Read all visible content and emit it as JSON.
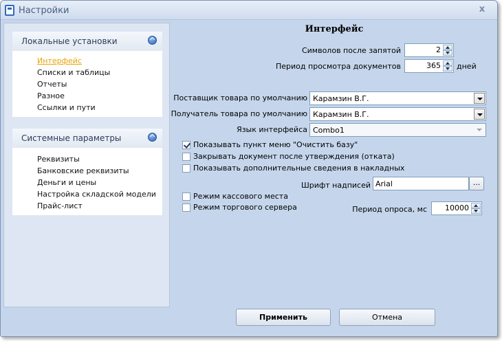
{
  "window": {
    "title": "Настройки",
    "close_glyph": "x"
  },
  "nav": {
    "local": {
      "title": "Локальные установки",
      "items": [
        "Интерфейс",
        "Списки и таблицы",
        "Отчеты",
        "Разное",
        "Ссылки и пути"
      ]
    },
    "system": {
      "title": "Системные параметры",
      "items": [
        "Реквизиты",
        "Банковские реквизиты",
        "Деньги и цены",
        "Настройка складской модели",
        "Прайс-лист"
      ]
    }
  },
  "form": {
    "heading": "Интерфейс",
    "decimals_label": "Символов после запятой",
    "decimals_value": "2",
    "period_label": "Период просмотра документов",
    "period_value": "365",
    "period_unit": "дней",
    "supplier_label": "Поставщик товара по умолчанию",
    "supplier_value": "Карамзин В.Г.",
    "receiver_label": "Получатель товара по умолчанию",
    "receiver_value": "Карамзин В.Г.",
    "language_label": "Язык интерфейса",
    "language_value": "Combo1",
    "check_clear_db": "Показывать пункт меню \"Очистить базу\"",
    "check_close_doc": "Закрывать документ после утверждения (отката)",
    "check_extra_info": "Показывать дополнительные сведения в накладных",
    "font_label": "Шрифт надписей",
    "font_value": "Arial",
    "font_button": "...",
    "check_cash_mode": "Режим кассового места",
    "check_server_mode": "Режим торгового сервера",
    "poll_label": "Период опроса, мс",
    "poll_value": "10000"
  },
  "buttons": {
    "apply": "Применить",
    "cancel": "Отмена"
  },
  "icons": {
    "app": "settings-window-icon",
    "collapse": "chevron-up-icon",
    "spin": "spin-arrows-icon",
    "dropdown": "dropdown-arrow-icon"
  },
  "colors": {
    "active_nav": "#e8a400",
    "window_bg": "#c5d6ec",
    "collapse_button": "#2e64b4"
  }
}
